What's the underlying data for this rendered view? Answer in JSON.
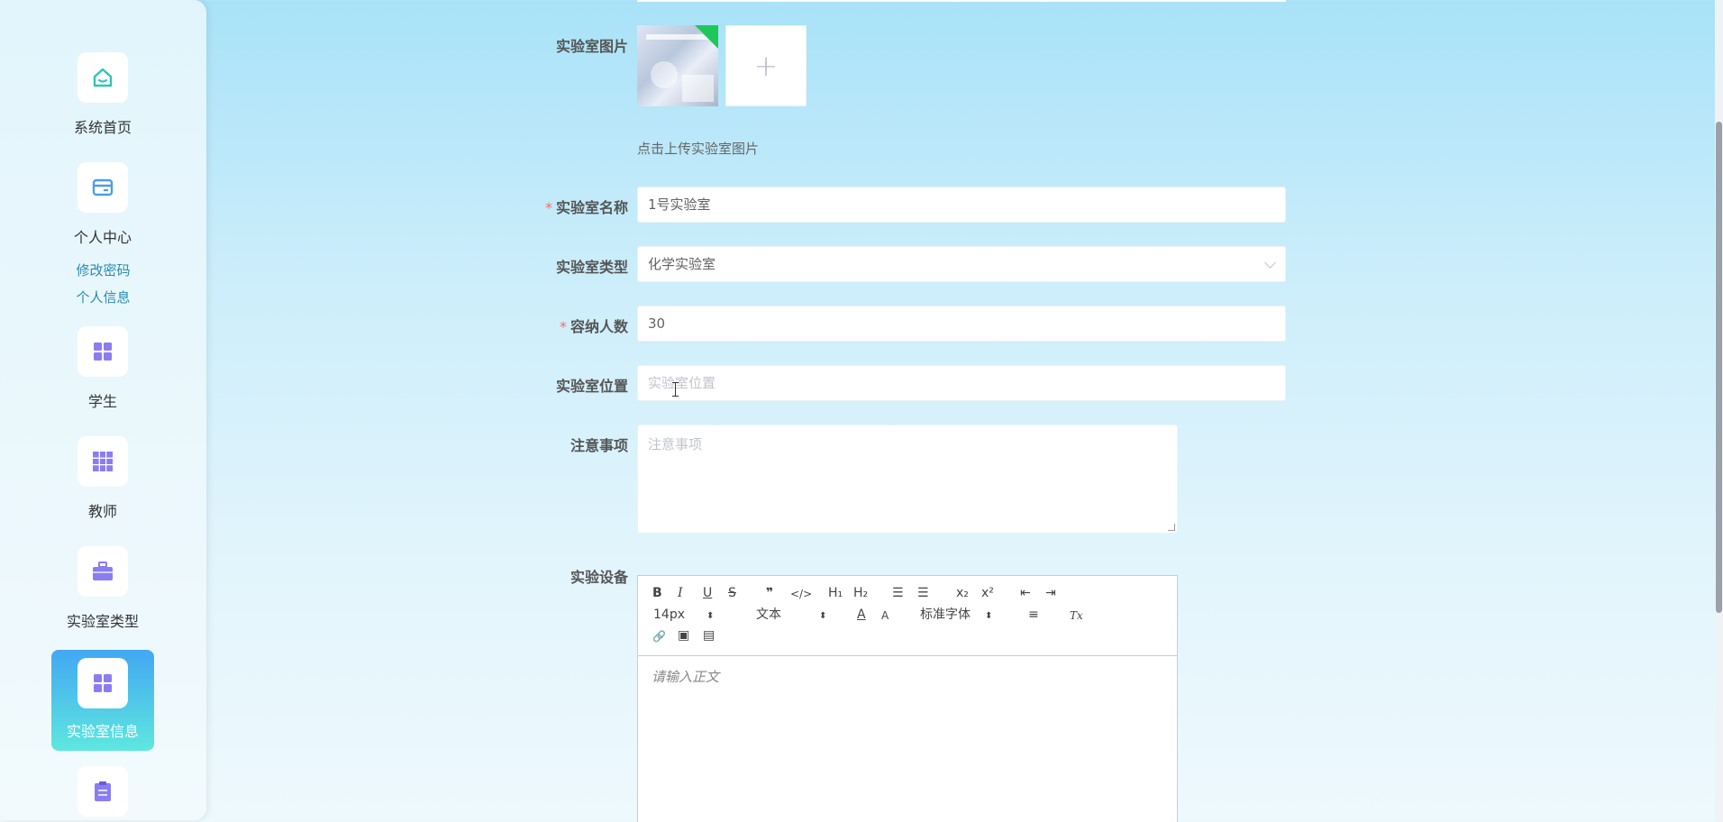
{
  "sidebar": {
    "items": [
      {
        "label": "系统首页",
        "icon": "home-icon"
      },
      {
        "label": "个人中心",
        "icon": "card-icon"
      },
      {
        "label": "学生",
        "icon": "grid-icon"
      },
      {
        "label": "教师",
        "icon": "table-icon"
      },
      {
        "label": "实验室类型",
        "icon": "briefcase-icon"
      },
      {
        "label": "实验室信息",
        "icon": "grid-icon"
      },
      {
        "label": "",
        "icon": "clipboard-icon"
      }
    ],
    "sub_links": [
      "修改密码",
      "个人信息"
    ],
    "active_index": 5
  },
  "form": {
    "image_label": "实验室图片",
    "upload_hint": "点击上传实验室图片",
    "upload_add": "+",
    "name_label": "实验室名称",
    "name_value": "1号实验室",
    "type_label": "实验室类型",
    "type_value": "化学实验室",
    "capacity_label": "容纳人数",
    "capacity_value": "30",
    "location_label": "实验室位置",
    "location_placeholder": "实验室位置",
    "notes_label": "注意事项",
    "notes_placeholder": "注意事项",
    "equipment_label": "实验设备",
    "required_mark": "*"
  },
  "editor": {
    "font_size": "14px",
    "block_type": "文本",
    "font_family": "标准字体",
    "placeholder": "请输入正文",
    "tools": {
      "bold": "B",
      "italic": "I",
      "underline": "U",
      "strike": "S",
      "quote": "❞",
      "code": "</>",
      "h1": "H₁",
      "h2": "H₂",
      "ordered": "☰",
      "bullet": "☰",
      "sub": "x₂",
      "sup": "x²",
      "outdent": "⇤",
      "indent": "⇥",
      "color": "A",
      "background": "A",
      "align": "≡",
      "clean": "Tx",
      "link": "🔗",
      "image": "▣",
      "video": "▤"
    }
  },
  "colors": {
    "accent": "#43a7f3",
    "icon_purple": "#8b7cf2",
    "icon_teal": "#2ec4b6",
    "icon_blue": "#4a9ee5",
    "required": "#f56c6c"
  }
}
